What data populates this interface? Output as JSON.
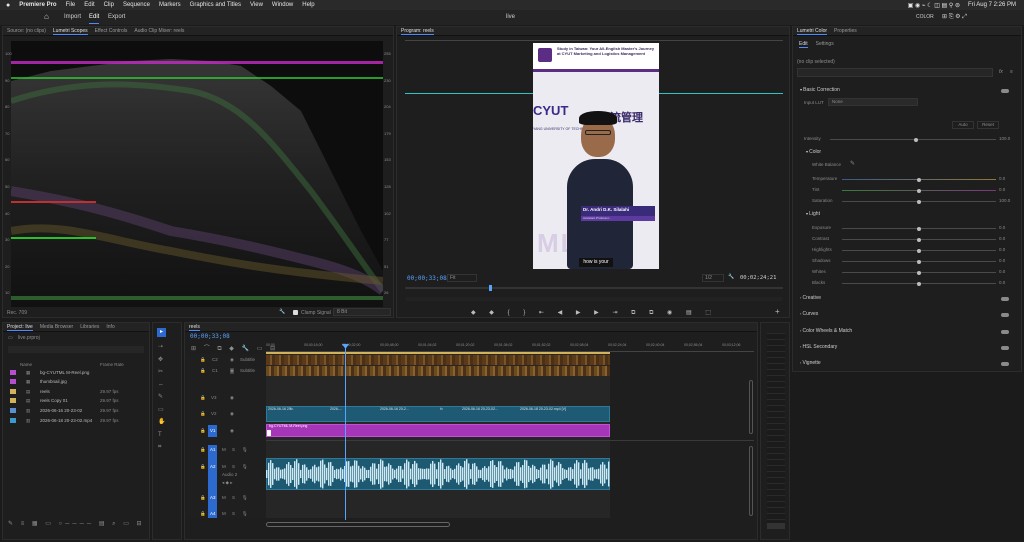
{
  "menubar": {
    "apple": "",
    "app": "Premiere Pro",
    "items": [
      "File",
      "Edit",
      "Clip",
      "Sequence",
      "Markers",
      "Graphics and Titles",
      "View",
      "Window",
      "Help"
    ],
    "datetime": "Fri Aug 7  2:26 PM"
  },
  "appbar": {
    "tabs": [
      "Import",
      "Edit",
      "Export"
    ],
    "active": "Edit",
    "title": "live",
    "workspace": "COLOR"
  },
  "source_panel": {
    "tabs": [
      "Source: (no clips)",
      "Lumetri Scopes",
      "Effect Controls",
      "Audio Clip Mixer: reels"
    ],
    "active": "Lumetri Scopes",
    "scale_left": [
      "100",
      "90",
      "80",
      "70",
      "60",
      "50",
      "40",
      "30",
      "20",
      "10",
      "0"
    ],
    "scale_right": [
      "255",
      "230",
      "204",
      "179",
      "153",
      "128",
      "102",
      "77",
      "51",
      "26",
      "0"
    ],
    "footer_left": "Rec. 709",
    "clamp_label": "Clamp Signal",
    "bit_depth": "8 Bit"
  },
  "program": {
    "title": "Program: reels",
    "timecode": "00;00;33;08",
    "fit": "Fit",
    "quality": "1/2",
    "duration": "00;02;24;21",
    "video_heading": "Study in Taiwan: Your All-English Master's Journey at CYUT Marketing and Logistics Management",
    "chinese_text": "物流管理",
    "cyut": "CYUT",
    "school_line": "YANG UNIVERSITY OF TECHNOLOGY",
    "lower_name": "Dr. Andri D.K. Silalahi",
    "lower_sub": "Assistant Professor...",
    "caption": "how is your",
    "watermark": "MLM"
  },
  "lumetri": {
    "tabs": [
      "Lumetri Color",
      "Properties"
    ],
    "subtabs": [
      "Edit",
      "Settings"
    ],
    "no_clip": "(no clip selected)",
    "fx": "fx",
    "sections": {
      "basic": "Basic Correction",
      "input_lut_label": "Input LUT",
      "input_lut_value": "None",
      "auto": "Auto",
      "reset": "Reset",
      "intensity": "Intensity",
      "intensity_val": "100.0",
      "color": "Color",
      "white_balance": "White Balance",
      "temperature": "Temperature",
      "tint": "Tint",
      "saturation": "Saturation",
      "temperature_val": "0.0",
      "tint_val": "0.0",
      "saturation_val": "100.0",
      "light": "Light",
      "exposure": "Exposure",
      "contrast": "Contrast",
      "highlights": "Highlights",
      "shadows": "Shadows",
      "whites": "Whites",
      "blacks": "Blacks",
      "exposure_val": "0.0",
      "contrast_val": "0.0",
      "highlights_val": "0.0",
      "shadows_val": "0.0",
      "whites_val": "0.0",
      "blacks_val": "0.0"
    },
    "collapsed": [
      "Creative",
      "Curves",
      "Color Wheels & Match",
      "HSL Secondary",
      "Vignette"
    ]
  },
  "project": {
    "tabs": [
      "Project: live",
      "Media Browser",
      "Libraries",
      "Info"
    ],
    "file": "live.prproj",
    "col_name": "Name",
    "col_rate": "Frame Rate",
    "items": [
      {
        "name": "bg-CYUTML M-Reel.png",
        "rate": "",
        "color": "#b44fd0"
      },
      {
        "name": "thumbnail.jpg",
        "rate": "",
        "color": "#b44fd0"
      },
      {
        "name": "reels",
        "rate": "29.97 fps",
        "color": "#d2b25a"
      },
      {
        "name": "reels Copy 01",
        "rate": "29.97 fps",
        "color": "#d2b25a"
      },
      {
        "name": "2026-06-16 20-23-02",
        "rate": "29.97 fps",
        "color": "#5a8fd2"
      },
      {
        "name": "2026-06-18 20-23-02.mp4",
        "rate": "29.97 fps",
        "color": "#3a9ad0"
      }
    ]
  },
  "timeline": {
    "tab": "reels",
    "timecode": "00;00;33;08",
    "ruler": [
      "00;00",
      "00;00;16;00",
      "00;00;32;00",
      "00;00;48;00",
      "00;01;04;02",
      "00;01;20;02",
      "00;01;36;02",
      "00;01;52;02",
      "00;02;08;04",
      "00;02;24;04",
      "00;02;40;04",
      "00;02;56;04",
      "00;03;12;06"
    ],
    "tracks": {
      "c2": "C2",
      "c1": "C1",
      "subtitle": "Subtitle",
      "v3": "V3",
      "v2": "V2",
      "v1": "V1",
      "a1": "A1",
      "a2": "A2",
      "a3": "A3",
      "a4": "A4",
      "audio2": "Audio 2",
      "m": "M",
      "s": "S"
    },
    "v2_clips": [
      "2026-06-16 20...",
      "2026-...",
      "2026-06-16 20-2...",
      "2026-06-16 20-23-02...",
      "2026-06-18 20-23-02.mp4 [V]"
    ],
    "v1_clip": "bg-CYUTML M-Reel.png",
    "fx": "fx"
  }
}
